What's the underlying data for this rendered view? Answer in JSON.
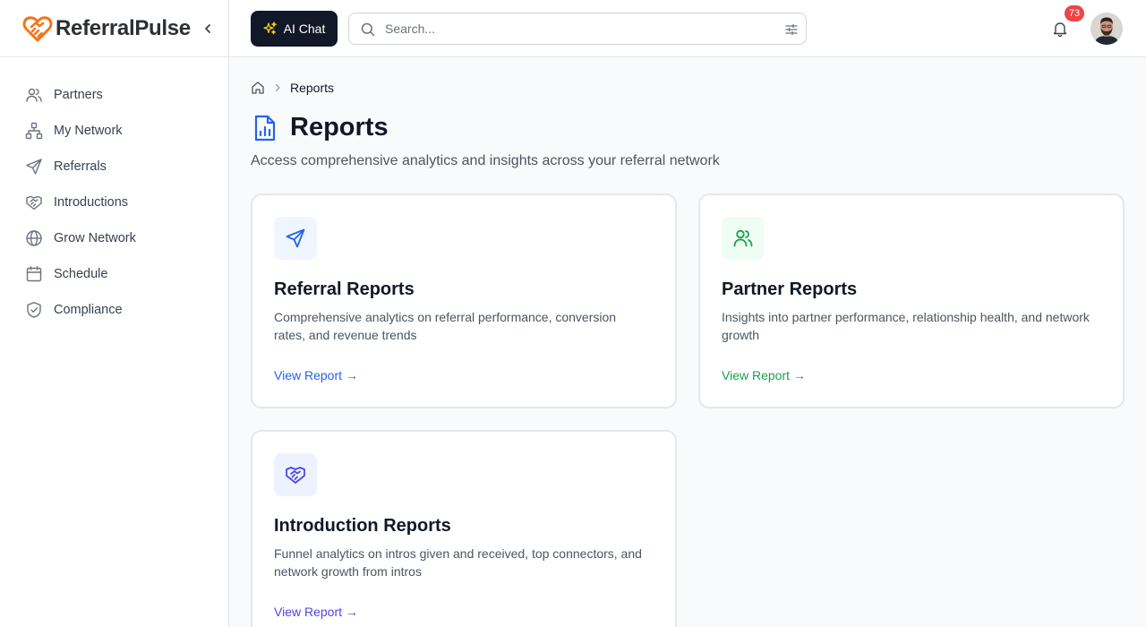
{
  "brand": {
    "name": "ReferralPulse"
  },
  "sidebar": {
    "items": [
      {
        "label": "Partners",
        "icon": "users-icon"
      },
      {
        "label": "My Network",
        "icon": "network-icon"
      },
      {
        "label": "Referrals",
        "icon": "send-icon"
      },
      {
        "label": "Introductions",
        "icon": "handshake-icon"
      },
      {
        "label": "Grow Network",
        "icon": "globe-icon"
      },
      {
        "label": "Schedule",
        "icon": "calendar-icon"
      },
      {
        "label": "Compliance",
        "icon": "shield-check-icon"
      }
    ]
  },
  "topbar": {
    "ai_chat_label": "AI Chat",
    "search_placeholder": "Search...",
    "search_value": "",
    "notification_count": "73"
  },
  "breadcrumb": {
    "current": "Reports"
  },
  "page": {
    "title": "Reports",
    "subtitle": "Access comprehensive analytics and insights across your referral network"
  },
  "cards": [
    {
      "title": "Referral Reports",
      "description": "Comprehensive analytics on referral performance, conversion rates, and revenue trends",
      "link": "View Report →",
      "icon": "send-icon",
      "accent": "#2563eb",
      "icon_bg": "#eff6ff"
    },
    {
      "title": "Partner Reports",
      "description": "Insights into partner performance, relationship health, and network growth",
      "link": "View Report →",
      "icon": "users-icon",
      "accent": "#16a34a",
      "icon_bg": "#f0fdf4"
    },
    {
      "title": "Introduction Reports",
      "description": "Funnel analytics on intros given and received, top connectors, and network growth from intros",
      "link": "View Report →",
      "icon": "handshake-icon",
      "accent": "#4f46e5",
      "icon_bg": "#eef2ff"
    }
  ],
  "colors": {
    "brand_orange": "#f97316",
    "text_dark": "#111827",
    "sidebar_icon": "#6b7280",
    "badge_red": "#ef4444",
    "ai_button_bg": "#111827",
    "sparkle_yellow": "#facc15"
  }
}
